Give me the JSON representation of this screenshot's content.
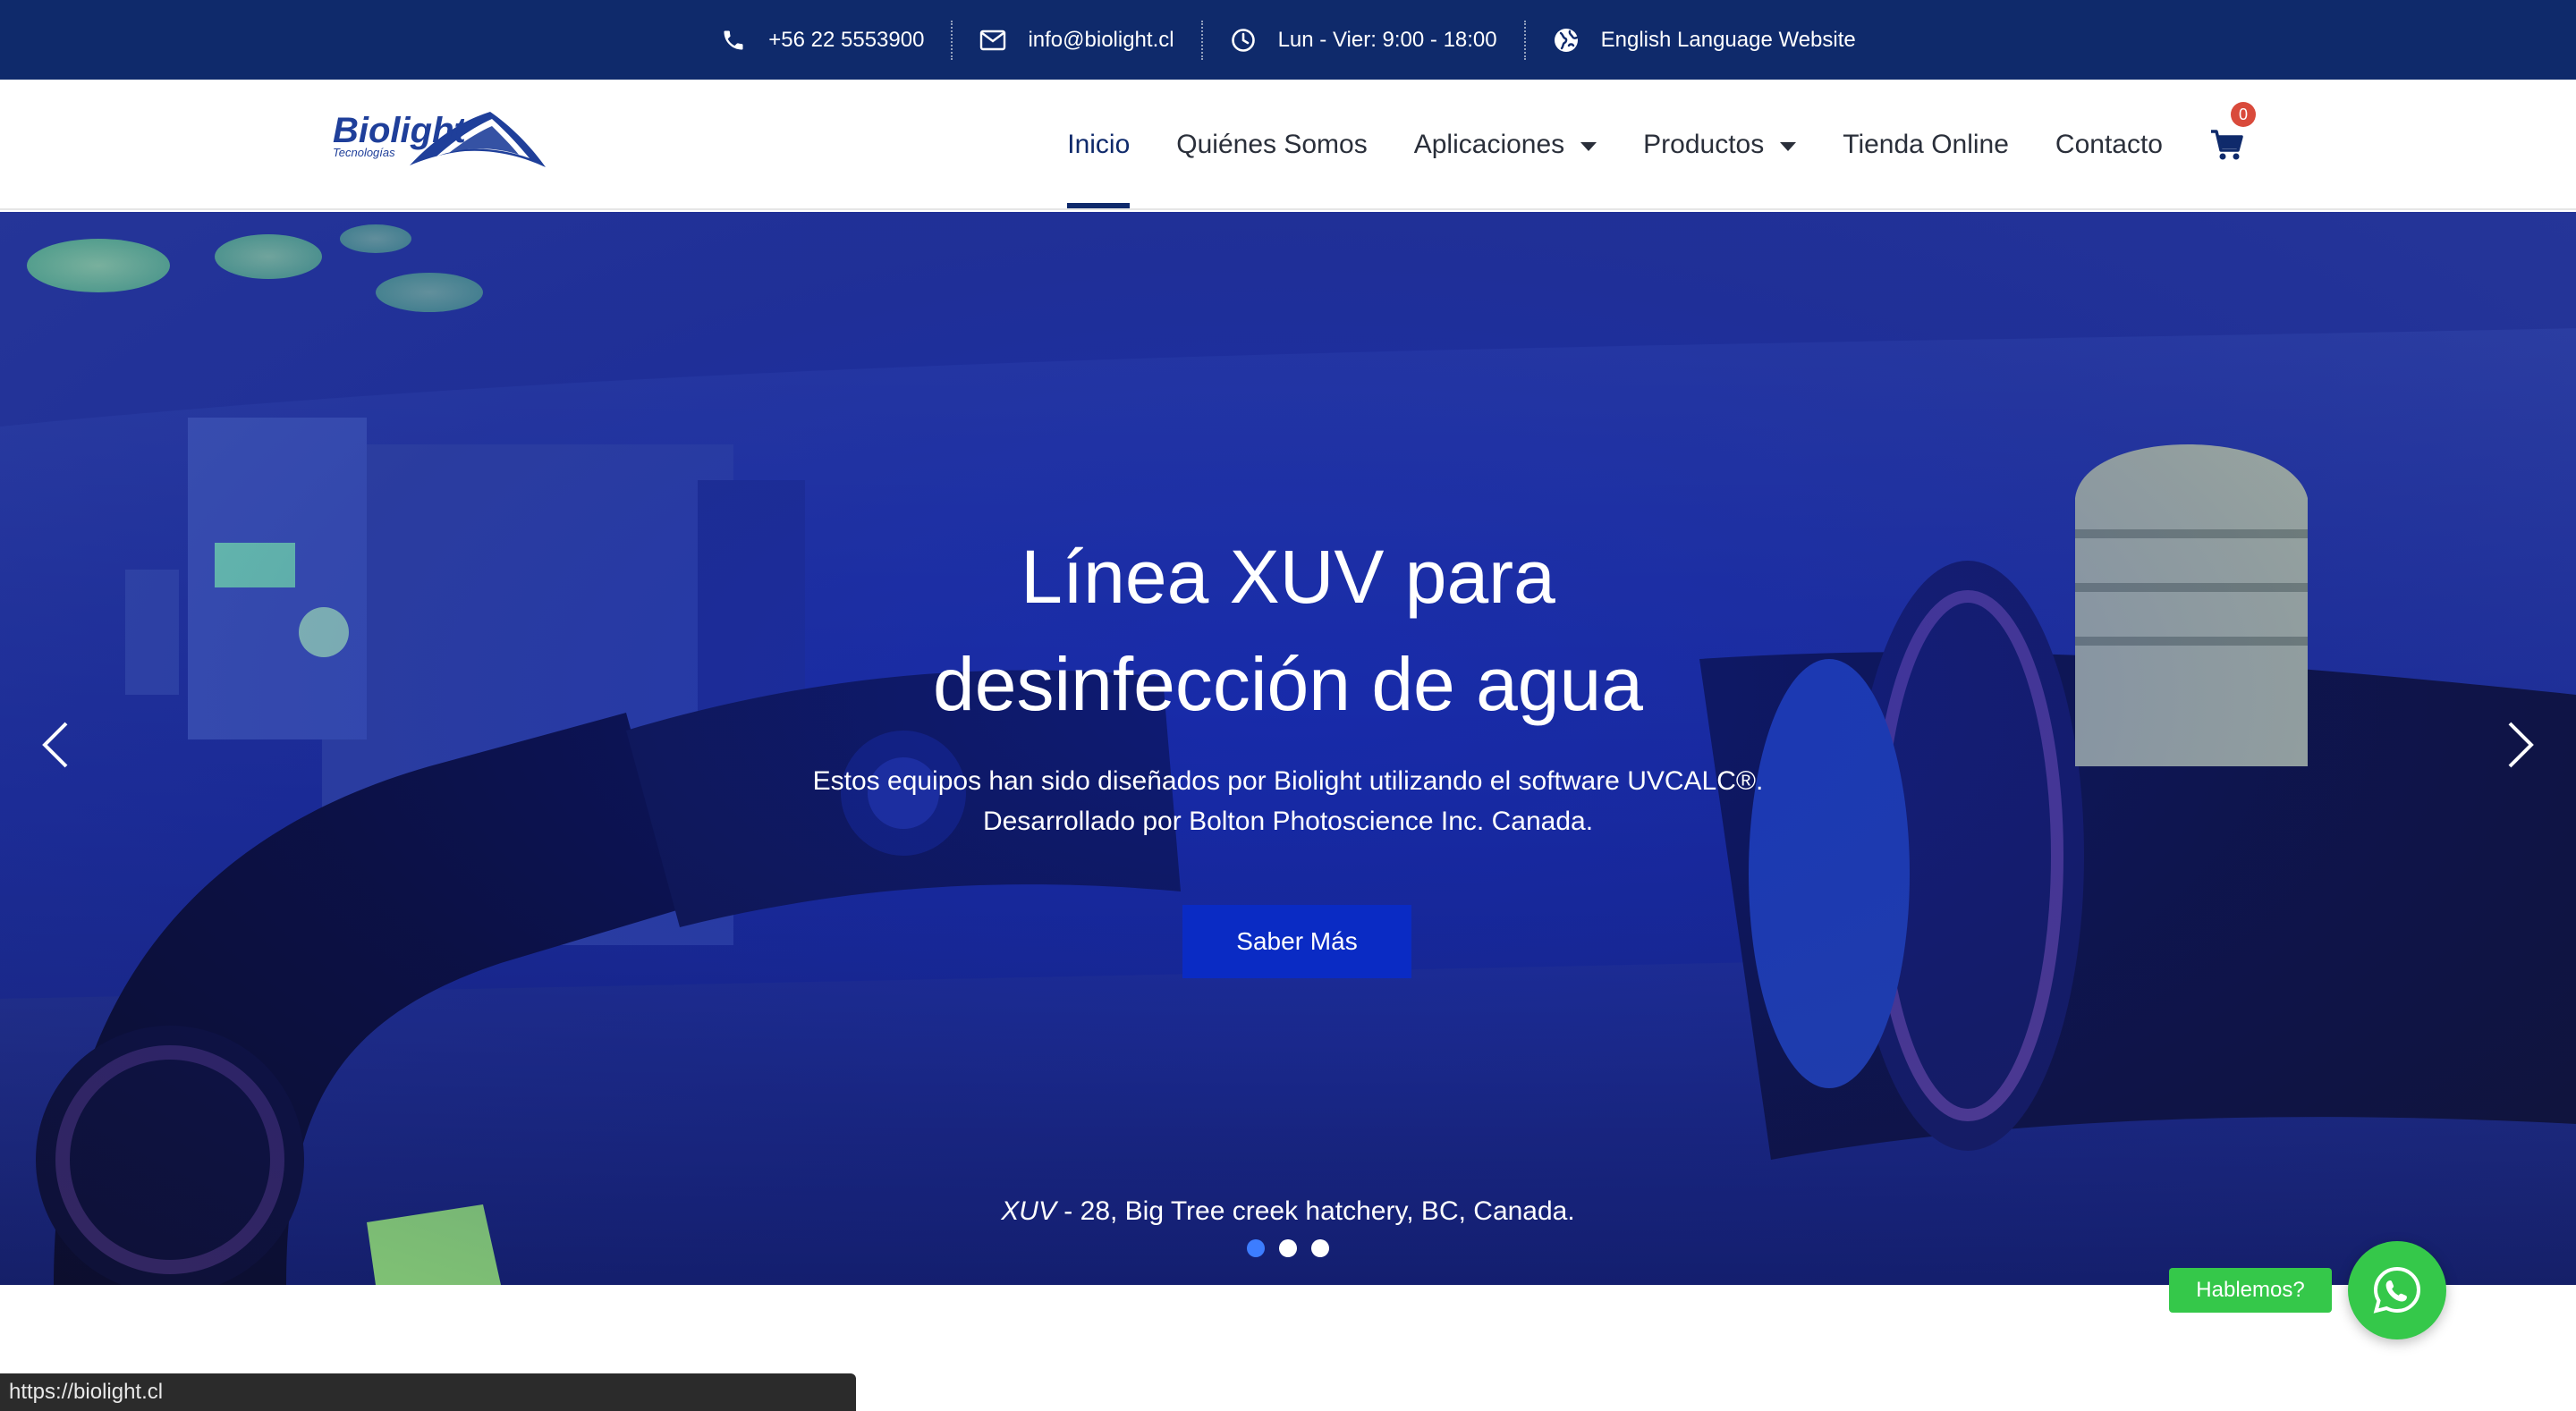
{
  "topbar": {
    "phone": "+56 22 5553900",
    "email": "info@biolight.cl",
    "hours": "Lun - Vier: 9:00 - 18:00",
    "language": "English Language Website",
    "icons": [
      "phone-icon",
      "envelope-icon",
      "clock-icon",
      "globe-icon"
    ]
  },
  "logo": {
    "brand": "Biolight",
    "tagline": "Tecnologías"
  },
  "nav": {
    "items": [
      {
        "label": "Inicio",
        "active": true
      },
      {
        "label": "Quiénes Somos"
      },
      {
        "label": "Aplicaciones",
        "dropdown": true
      },
      {
        "label": "Productos",
        "dropdown": true
      },
      {
        "label": "Tienda Online"
      },
      {
        "label": "Contacto"
      }
    ],
    "cart_count": "0"
  },
  "hero": {
    "title_line1": "Línea XUV para",
    "title_line2": "desinfección de agua",
    "subtitle_line1": "Estos equipos han sido diseñados por Biolight utilizando el software UVCALC®.",
    "subtitle_line2": "Desarrollado por Bolton Photoscience Inc. Canada.",
    "button_label": "Saber Más",
    "caption_model": "XUV",
    "caption_rest": " - 28, Big Tree creek hatchery, BC, Canada.",
    "slide_count": 3,
    "active_slide": 1
  },
  "whatsapp": {
    "label": "Hablemos?"
  },
  "status_bar": {
    "url": "https://biolight.cl"
  },
  "colors": {
    "topbar_bg": "#0f2a6b",
    "nav_active": "#0f2a6b",
    "hero_button": "#0a2bc4",
    "whatsapp_green": "#35c84a",
    "cart_badge": "#d94a3b",
    "active_dot": "#3d7dff"
  }
}
